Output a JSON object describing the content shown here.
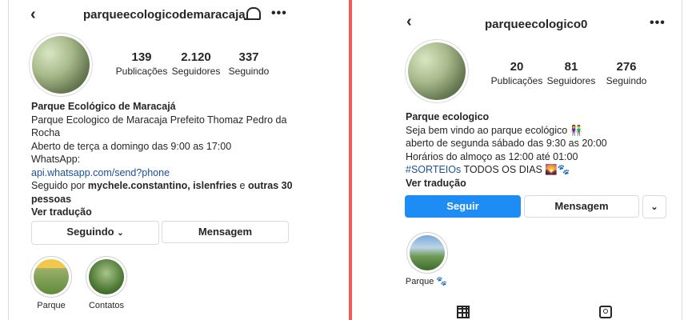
{
  "left": {
    "username": "parqueecologicodemaracaja",
    "stats": [
      {
        "value": "139",
        "label": "Publicações"
      },
      {
        "value": "2.120",
        "label": "Seguidores"
      },
      {
        "value": "337",
        "label": "Seguindo"
      }
    ],
    "bio": {
      "name": "Parque Ecológico de Maracajá",
      "line1": "Parque Ecologico de Maracaja Prefeito Thomaz Pedro da",
      "line2": "Rocha",
      "line3": "Aberto de terça a domingo das 9:00 as 17:00",
      "line4": "WhatsApp:",
      "link": "api.whatsapp.com/send?phone",
      "followed_prefix": "Seguido por ",
      "followed_names": "mychele.constantino, islenfries",
      "followed_mid": " e ",
      "followed_others": "outras 30",
      "followed_others2": "pessoas",
      "see_translation": "Ver tradução"
    },
    "buttons": {
      "following": "Seguindo",
      "message": "Mensagem"
    },
    "highlights": [
      {
        "label": "Parque"
      },
      {
        "label": "Contatos"
      }
    ]
  },
  "right": {
    "username": "parqueecologico0",
    "stats": [
      {
        "value": "20",
        "label": "Publicações"
      },
      {
        "value": "81",
        "label": "Seguidores"
      },
      {
        "value": "276",
        "label": "Seguindo"
      }
    ],
    "bio": {
      "name": "Parque ecologico",
      "line1": "Seja bem vindo ao parque ecológico 👫",
      "line2": "aberto de segunda sábado das 9:30 as 20:00",
      "line3": "Horários do almoço as 12:00 até 01:00",
      "hashtag": "#SORTEIOs",
      "line4_rest": " TODOS OS DIAS 🌄🐾",
      "see_translation": "Ver tradução"
    },
    "buttons": {
      "follow": "Seguir",
      "message": "Mensagem"
    },
    "highlights": [
      {
        "label": "Parque 🐾"
      }
    ]
  },
  "colors": {
    "accent": "#1d8cf5",
    "link": "#1b4f9c",
    "divider": "#ef5b5b"
  }
}
